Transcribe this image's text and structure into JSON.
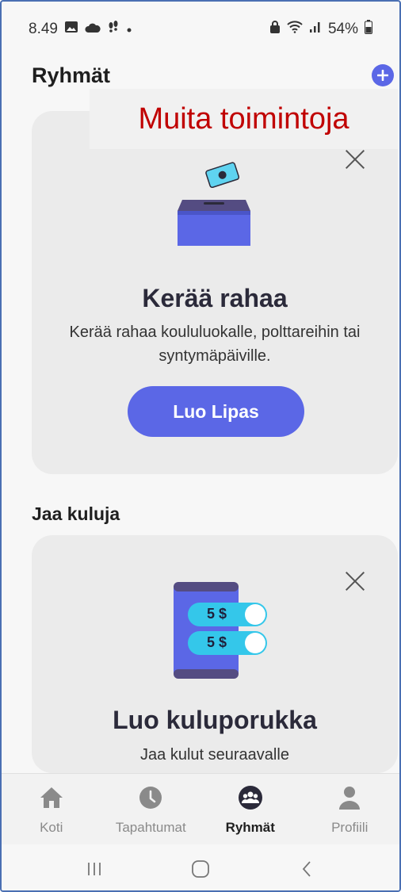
{
  "status_bar": {
    "time": "8.49",
    "battery": "54%"
  },
  "header": {
    "title": "Ryhmät",
    "add_icon": "plus-circle-icon"
  },
  "overlay": {
    "label": "Muita toimintoja"
  },
  "card_collect": {
    "title": "Kerää rahaa",
    "description": "Kerää rahaa koululuokalle, polttareihin tai syntymäpäiville.",
    "button": "Luo Lipas"
  },
  "section_share": {
    "label": "Jaa kuluja"
  },
  "card_share": {
    "amount_1": "5 $",
    "amount_2": "5 $",
    "title": "Luo kuluporukka",
    "subtitle": "Jaa kulut seuraavalle"
  },
  "bottom_nav": {
    "items": [
      {
        "label": "Koti",
        "icon": "home-icon"
      },
      {
        "label": "Tapahtumat",
        "icon": "clock-icon"
      },
      {
        "label": "Ryhmät",
        "icon": "group-icon"
      },
      {
        "label": "Profiili",
        "icon": "person-icon"
      }
    ],
    "active": "Ryhmät"
  },
  "colors": {
    "accent": "#5b67e6",
    "overlay_text": "#c00000",
    "card_bg": "#ebebeb"
  }
}
